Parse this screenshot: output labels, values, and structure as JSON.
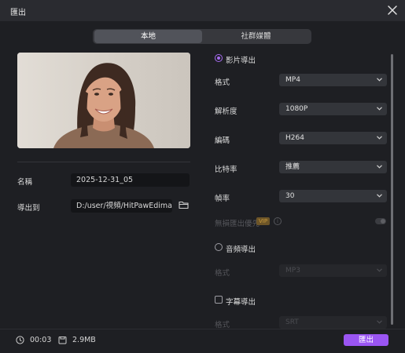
{
  "window": {
    "title": "匯出"
  },
  "tabs": [
    {
      "label": "本地",
      "active": true
    },
    {
      "label": "社群媒體",
      "active": false
    }
  ],
  "left": {
    "name_label": "名稱",
    "name_value": "2025-12-31_05",
    "export_to_label": "導出到",
    "export_to_value": "D:/user/視頻/HitPawEdimakor"
  },
  "right": {
    "video_export": {
      "label": "影片導出",
      "selected": true
    },
    "format": {
      "label": "格式",
      "value": "MP4"
    },
    "resolution": {
      "label": "解析度",
      "value": "1080P"
    },
    "codec": {
      "label": "編碼",
      "value": "H264"
    },
    "bitrate": {
      "label": "比特率",
      "value": "推薦"
    },
    "framerate": {
      "label": "幀率",
      "value": "30"
    },
    "lossless": {
      "label": "無損匯出優先",
      "badge": "VIP",
      "info": "i",
      "enabled": false
    },
    "audio_export": {
      "label": "音頻導出",
      "selected": false
    },
    "audio_format": {
      "label": "格式",
      "value": "MP3"
    },
    "subtitle_export": {
      "label": "字幕導出",
      "checked": false
    },
    "subtitle_format": {
      "label": "格式",
      "value": "SRT"
    }
  },
  "footer": {
    "duration": "00:03",
    "size": "2.9MB",
    "export_button": "匯出"
  },
  "colors": {
    "accent": "#9a55f2",
    "background": "#1e1f23",
    "titlebar": "#2a2b30"
  },
  "icons": [
    "close-icon",
    "folder-icon",
    "clock-icon",
    "file-icon",
    "chevron-down-icon",
    "info-icon"
  ]
}
